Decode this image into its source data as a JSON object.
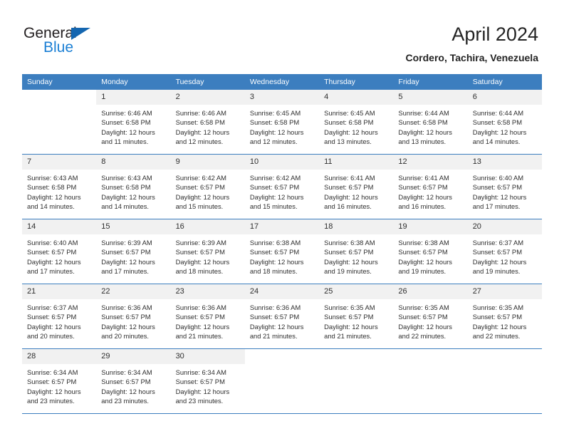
{
  "brand": {
    "name_dark": "General",
    "name_blue": "Blue",
    "accent_blue": "#1b7fd4",
    "triangle_blue": "#1466b0"
  },
  "header": {
    "title": "April 2024",
    "subtitle": "Cordero, Tachira, Venezuela",
    "header_bg": "#3c7ebf",
    "daynum_bg": "#f1f1f1"
  },
  "weekday_headers": [
    "Sunday",
    "Monday",
    "Tuesday",
    "Wednesday",
    "Thursday",
    "Friday",
    "Saturday"
  ],
  "weeks": [
    [
      {
        "day": "",
        "empty": true,
        "sunrise": "",
        "sunset": "",
        "daylight1": "",
        "daylight2": ""
      },
      {
        "day": "1",
        "sunrise": "Sunrise: 6:46 AM",
        "sunset": "Sunset: 6:58 PM",
        "daylight1": "Daylight: 12 hours",
        "daylight2": "and 11 minutes."
      },
      {
        "day": "2",
        "sunrise": "Sunrise: 6:46 AM",
        "sunset": "Sunset: 6:58 PM",
        "daylight1": "Daylight: 12 hours",
        "daylight2": "and 12 minutes."
      },
      {
        "day": "3",
        "sunrise": "Sunrise: 6:45 AM",
        "sunset": "Sunset: 6:58 PM",
        "daylight1": "Daylight: 12 hours",
        "daylight2": "and 12 minutes."
      },
      {
        "day": "4",
        "sunrise": "Sunrise: 6:45 AM",
        "sunset": "Sunset: 6:58 PM",
        "daylight1": "Daylight: 12 hours",
        "daylight2": "and 13 minutes."
      },
      {
        "day": "5",
        "sunrise": "Sunrise: 6:44 AM",
        "sunset": "Sunset: 6:58 PM",
        "daylight1": "Daylight: 12 hours",
        "daylight2": "and 13 minutes."
      },
      {
        "day": "6",
        "sunrise": "Sunrise: 6:44 AM",
        "sunset": "Sunset: 6:58 PM",
        "daylight1": "Daylight: 12 hours",
        "daylight2": "and 14 minutes."
      }
    ],
    [
      {
        "day": "7",
        "sunrise": "Sunrise: 6:43 AM",
        "sunset": "Sunset: 6:58 PM",
        "daylight1": "Daylight: 12 hours",
        "daylight2": "and 14 minutes."
      },
      {
        "day": "8",
        "sunrise": "Sunrise: 6:43 AM",
        "sunset": "Sunset: 6:58 PM",
        "daylight1": "Daylight: 12 hours",
        "daylight2": "and 14 minutes."
      },
      {
        "day": "9",
        "sunrise": "Sunrise: 6:42 AM",
        "sunset": "Sunset: 6:57 PM",
        "daylight1": "Daylight: 12 hours",
        "daylight2": "and 15 minutes."
      },
      {
        "day": "10",
        "sunrise": "Sunrise: 6:42 AM",
        "sunset": "Sunset: 6:57 PM",
        "daylight1": "Daylight: 12 hours",
        "daylight2": "and 15 minutes."
      },
      {
        "day": "11",
        "sunrise": "Sunrise: 6:41 AM",
        "sunset": "Sunset: 6:57 PM",
        "daylight1": "Daylight: 12 hours",
        "daylight2": "and 16 minutes."
      },
      {
        "day": "12",
        "sunrise": "Sunrise: 6:41 AM",
        "sunset": "Sunset: 6:57 PM",
        "daylight1": "Daylight: 12 hours",
        "daylight2": "and 16 minutes."
      },
      {
        "day": "13",
        "sunrise": "Sunrise: 6:40 AM",
        "sunset": "Sunset: 6:57 PM",
        "daylight1": "Daylight: 12 hours",
        "daylight2": "and 17 minutes."
      }
    ],
    [
      {
        "day": "14",
        "sunrise": "Sunrise: 6:40 AM",
        "sunset": "Sunset: 6:57 PM",
        "daylight1": "Daylight: 12 hours",
        "daylight2": "and 17 minutes."
      },
      {
        "day": "15",
        "sunrise": "Sunrise: 6:39 AM",
        "sunset": "Sunset: 6:57 PM",
        "daylight1": "Daylight: 12 hours",
        "daylight2": "and 17 minutes."
      },
      {
        "day": "16",
        "sunrise": "Sunrise: 6:39 AM",
        "sunset": "Sunset: 6:57 PM",
        "daylight1": "Daylight: 12 hours",
        "daylight2": "and 18 minutes."
      },
      {
        "day": "17",
        "sunrise": "Sunrise: 6:38 AM",
        "sunset": "Sunset: 6:57 PM",
        "daylight1": "Daylight: 12 hours",
        "daylight2": "and 18 minutes."
      },
      {
        "day": "18",
        "sunrise": "Sunrise: 6:38 AM",
        "sunset": "Sunset: 6:57 PM",
        "daylight1": "Daylight: 12 hours",
        "daylight2": "and 19 minutes."
      },
      {
        "day": "19",
        "sunrise": "Sunrise: 6:38 AM",
        "sunset": "Sunset: 6:57 PM",
        "daylight1": "Daylight: 12 hours",
        "daylight2": "and 19 minutes."
      },
      {
        "day": "20",
        "sunrise": "Sunrise: 6:37 AM",
        "sunset": "Sunset: 6:57 PM",
        "daylight1": "Daylight: 12 hours",
        "daylight2": "and 19 minutes."
      }
    ],
    [
      {
        "day": "21",
        "sunrise": "Sunrise: 6:37 AM",
        "sunset": "Sunset: 6:57 PM",
        "daylight1": "Daylight: 12 hours",
        "daylight2": "and 20 minutes."
      },
      {
        "day": "22",
        "sunrise": "Sunrise: 6:36 AM",
        "sunset": "Sunset: 6:57 PM",
        "daylight1": "Daylight: 12 hours",
        "daylight2": "and 20 minutes."
      },
      {
        "day": "23",
        "sunrise": "Sunrise: 6:36 AM",
        "sunset": "Sunset: 6:57 PM",
        "daylight1": "Daylight: 12 hours",
        "daylight2": "and 21 minutes."
      },
      {
        "day": "24",
        "sunrise": "Sunrise: 6:36 AM",
        "sunset": "Sunset: 6:57 PM",
        "daylight1": "Daylight: 12 hours",
        "daylight2": "and 21 minutes."
      },
      {
        "day": "25",
        "sunrise": "Sunrise: 6:35 AM",
        "sunset": "Sunset: 6:57 PM",
        "daylight1": "Daylight: 12 hours",
        "daylight2": "and 21 minutes."
      },
      {
        "day": "26",
        "sunrise": "Sunrise: 6:35 AM",
        "sunset": "Sunset: 6:57 PM",
        "daylight1": "Daylight: 12 hours",
        "daylight2": "and 22 minutes."
      },
      {
        "day": "27",
        "sunrise": "Sunrise: 6:35 AM",
        "sunset": "Sunset: 6:57 PM",
        "daylight1": "Daylight: 12 hours",
        "daylight2": "and 22 minutes."
      }
    ],
    [
      {
        "day": "28",
        "sunrise": "Sunrise: 6:34 AM",
        "sunset": "Sunset: 6:57 PM",
        "daylight1": "Daylight: 12 hours",
        "daylight2": "and 23 minutes."
      },
      {
        "day": "29",
        "sunrise": "Sunrise: 6:34 AM",
        "sunset": "Sunset: 6:57 PM",
        "daylight1": "Daylight: 12 hours",
        "daylight2": "and 23 minutes."
      },
      {
        "day": "30",
        "sunrise": "Sunrise: 6:34 AM",
        "sunset": "Sunset: 6:57 PM",
        "daylight1": "Daylight: 12 hours",
        "daylight2": "and 23 minutes."
      },
      {
        "day": "",
        "empty": true,
        "sunrise": "",
        "sunset": "",
        "daylight1": "",
        "daylight2": ""
      },
      {
        "day": "",
        "empty": true,
        "sunrise": "",
        "sunset": "",
        "daylight1": "",
        "daylight2": ""
      },
      {
        "day": "",
        "empty": true,
        "sunrise": "",
        "sunset": "",
        "daylight1": "",
        "daylight2": ""
      },
      {
        "day": "",
        "empty": true,
        "sunrise": "",
        "sunset": "",
        "daylight1": "",
        "daylight2": ""
      }
    ]
  ]
}
